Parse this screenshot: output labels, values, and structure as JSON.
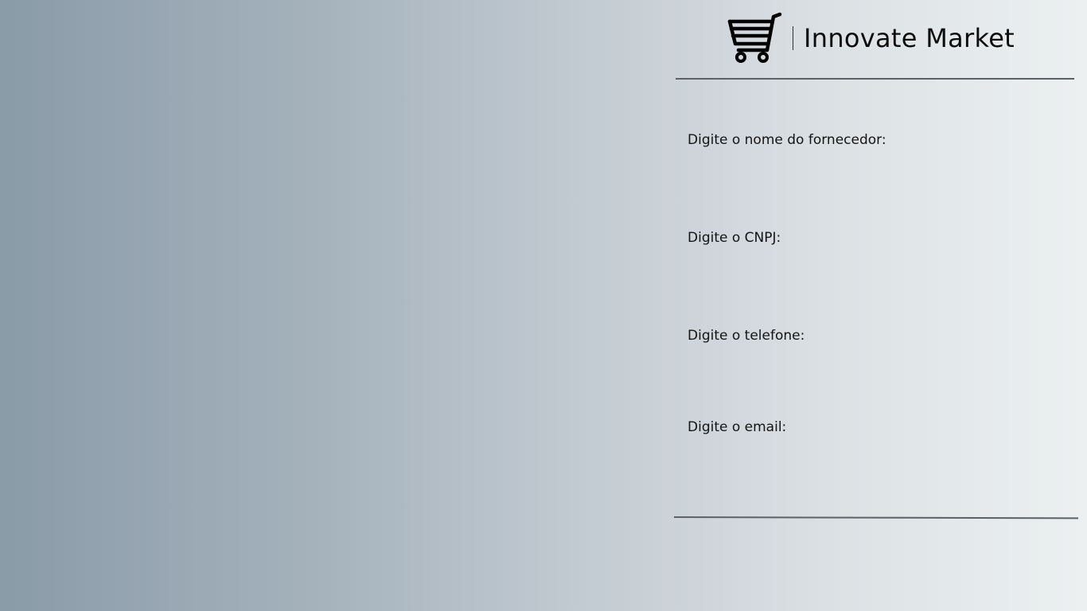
{
  "header": {
    "logo_icon": "shopping-cart-icon",
    "brand_name": "Innovate Market"
  },
  "form": {
    "fields": [
      {
        "label": "Digite o nome do fornecedor:",
        "value": "",
        "placeholder": ""
      },
      {
        "label": "Digite o CNPJ:",
        "value": "",
        "placeholder": ""
      },
      {
        "label": "Digite o telefone:",
        "value": "",
        "placeholder": ""
      },
      {
        "label": "Digite o email:",
        "value": "",
        "placeholder": ""
      }
    ]
  },
  "colors": {
    "background_left": "#8a9ba8",
    "background_right": "#ecf0f1",
    "rule": "#5c6166",
    "text": "#111111"
  }
}
